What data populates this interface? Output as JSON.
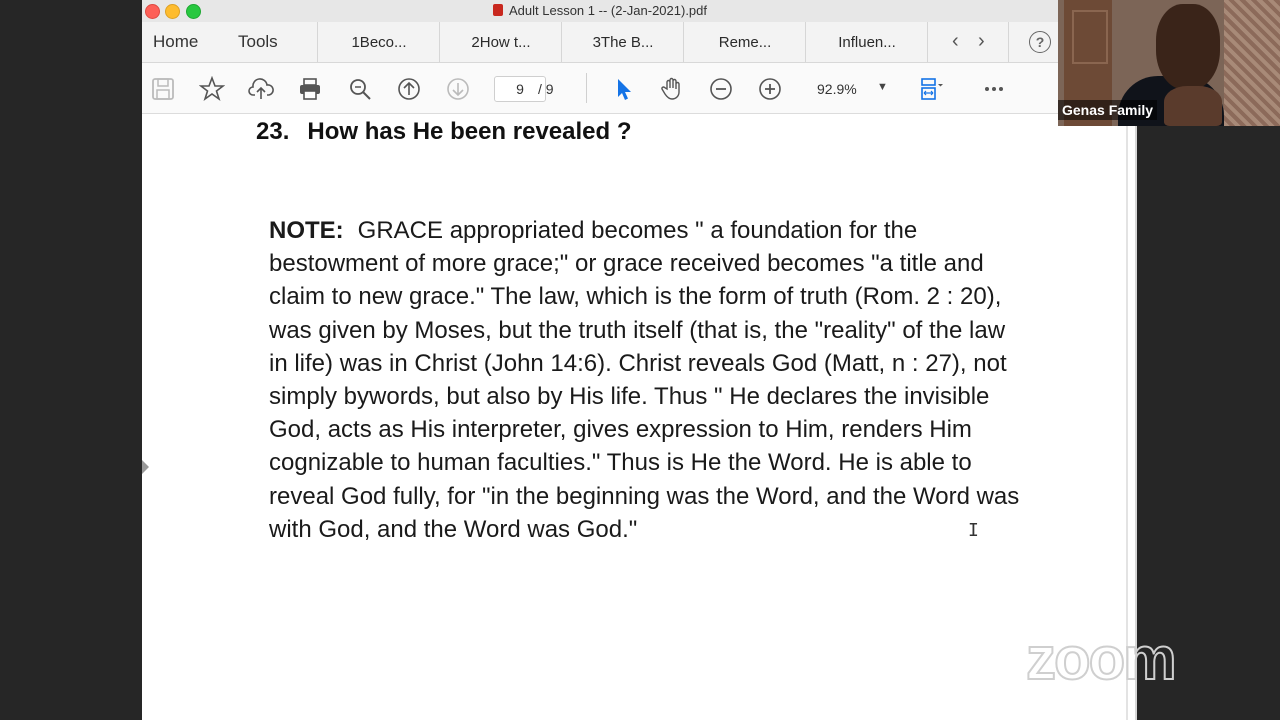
{
  "window": {
    "title": "Adult Lesson 1 -- (2-Jan-2021).pdf"
  },
  "nav": {
    "home": "Home",
    "tools": "Tools"
  },
  "tabs": [
    {
      "label": "1Beco..."
    },
    {
      "label": "2How t..."
    },
    {
      "label": "3The B..."
    },
    {
      "label": "Reme..."
    },
    {
      "label": "Influen..."
    }
  ],
  "toolbar": {
    "current_page": "9",
    "total_pages": "/ 9",
    "zoom": "92.9%",
    "icons": [
      "save-icon",
      "star-icon",
      "upload-icon",
      "print-icon",
      "search-zoom-icon",
      "page-up-icon",
      "page-down-icon",
      "select-pointer-icon",
      "hand-icon",
      "zoom-out-icon",
      "zoom-in-icon",
      "fit-page-icon",
      "more-icon"
    ]
  },
  "document": {
    "heading_number": "23.",
    "heading_text": "How has He been revealed ?",
    "note_label": "NOTE:",
    "note_text": "GRACE appropriated becomes \" a foundation for the bestowment of more grace;\" or grace received becomes \"a title and claim to new grace.\" The law, which is the form of truth (Rom. 2 : 20), was given by Moses, but the truth itself (that is, the \"reality\" of the law in life) was in Christ (John 14:6). Christ reveals God (Matt, n : 27), not simply bywords, but also by His life. Thus \" He declares the invisible God, acts as His interpreter, gives expression to Him, renders Him cognizable to human faculties.\" Thus is He the Word. He is able to reveal God fully, for \"in the beginning was the Word, and the Word was with God, and the Word was God.\""
  },
  "video": {
    "participant_name": "Genas Family"
  },
  "branding": {
    "logo_text": "zoom"
  }
}
